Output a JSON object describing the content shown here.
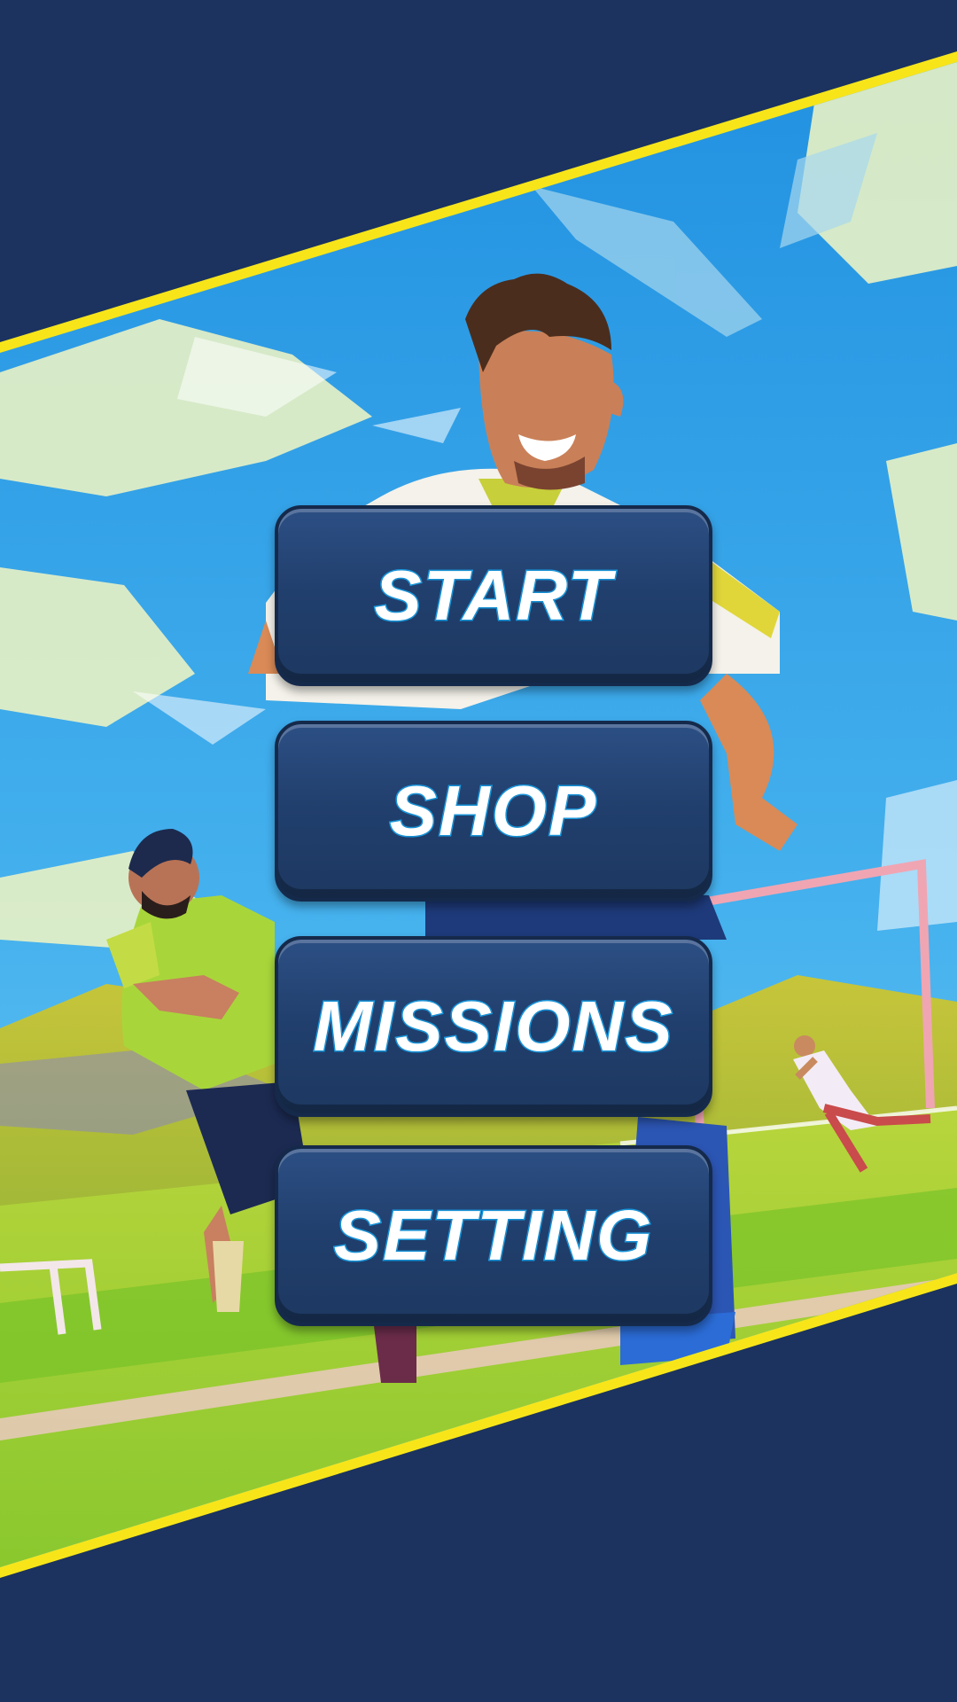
{
  "menu": {
    "start_label": "START",
    "shop_label": "SHOP",
    "missions_label": "MISSIONS",
    "setting_label": "SETTING"
  },
  "colors": {
    "background": "#1b335e",
    "banner_border": "#f7e51a",
    "sky": "#2f9ee6",
    "grass": "#9bd43a",
    "button_face": "#233f6c",
    "button_text": "#ffffff",
    "button_text_outline": "#1aa0e6"
  },
  "icons": {
    "artwork": "soccer-players-illustration"
  }
}
